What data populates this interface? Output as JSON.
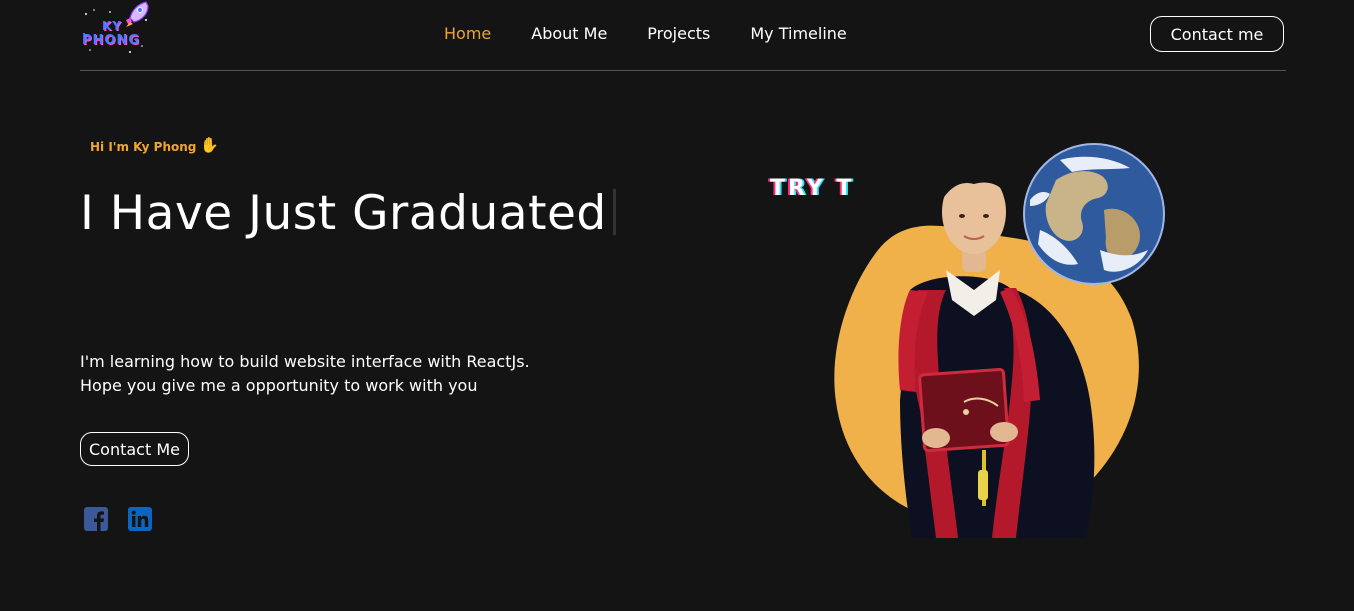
{
  "header": {
    "logo_line1": "KY",
    "logo_line2": "PHONG",
    "nav": [
      {
        "label": "Home",
        "active": true
      },
      {
        "label": "About Me",
        "active": false
      },
      {
        "label": "Projects",
        "active": false
      },
      {
        "label": "My Timeline",
        "active": false
      }
    ],
    "contact_label": "Contact me"
  },
  "hero": {
    "greeting": "Hi I'm Ky Phong",
    "greeting_icon": "raised-hand-icon",
    "headline": "I Have Just Graduated",
    "description_line1": "I'm learning how to build website interface with ReactJs.",
    "description_line2": "Hope you give me a opportunity to work with you",
    "cta_label": "Contact Me",
    "animated_text": "TRY T"
  },
  "social": [
    {
      "name": "facebook-icon",
      "color": "#3b5998"
    },
    {
      "name": "linkedin-icon",
      "color": "#0a66c2"
    }
  ],
  "colors": {
    "background": "#141414",
    "accent": "#f0a433",
    "orange_blob": "#f0b04a"
  }
}
